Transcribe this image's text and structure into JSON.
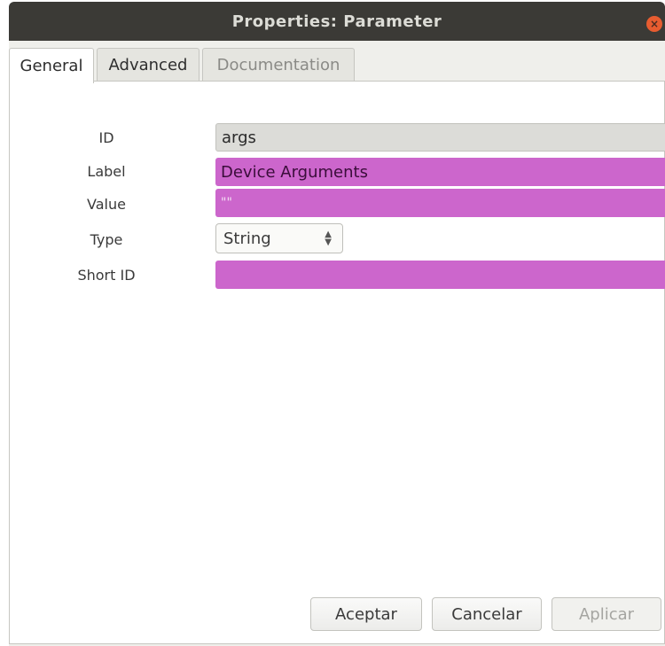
{
  "window": {
    "title": "Properties: Parameter",
    "close_glyph": "×"
  },
  "tabs": [
    {
      "label": "General",
      "active": true
    },
    {
      "label": "Advanced",
      "active": false
    },
    {
      "label": "Documentation",
      "active": false,
      "disabled": true
    }
  ],
  "form": {
    "id": {
      "label": "ID",
      "value": "args"
    },
    "label": {
      "label": "Label",
      "value": "Device Arguments"
    },
    "value": {
      "label": "Value",
      "value": "\"\""
    },
    "type": {
      "label": "Type",
      "value": "String"
    },
    "short_id": {
      "label": "Short ID",
      "value": ""
    }
  },
  "buttons": {
    "ok": "Aceptar",
    "cancel": "Cancelar",
    "apply": "Aplicar"
  },
  "colors": {
    "titlebar": "#3b3a36",
    "highlight_field": "#cc66cc",
    "close_button": "#e75c30"
  },
  "icons": {
    "close": "close-icon",
    "select_arrows": "up-down-arrows-icon"
  }
}
